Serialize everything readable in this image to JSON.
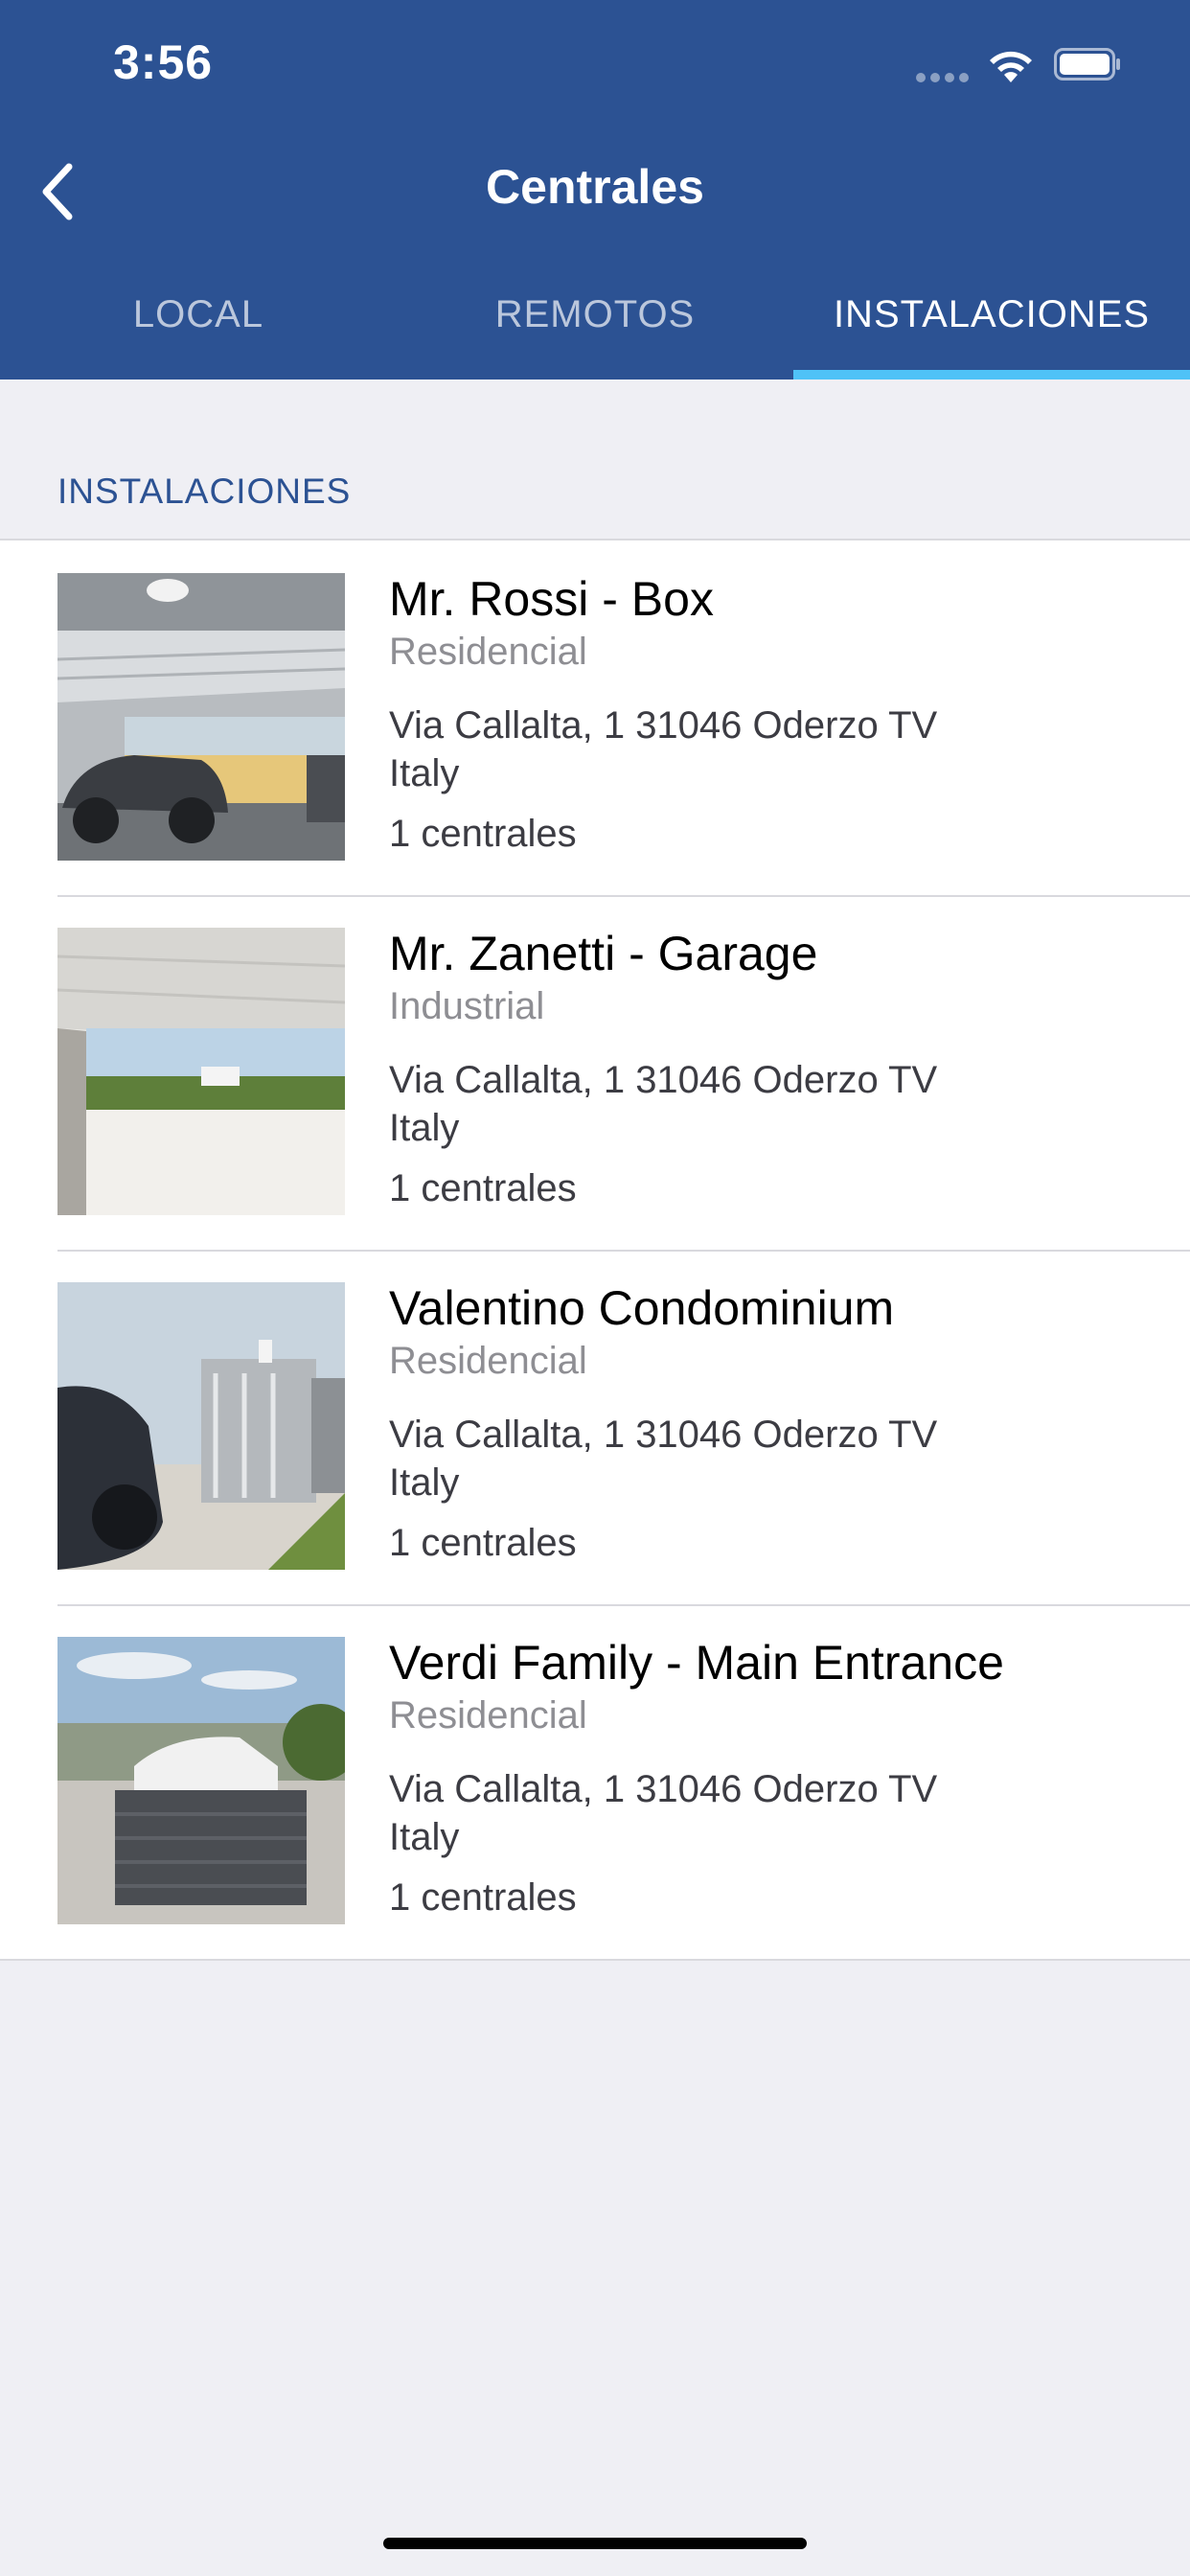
{
  "status_bar": {
    "time": "3:56"
  },
  "nav": {
    "title": "Centrales",
    "back_icon": "chevron-left-icon"
  },
  "tabs": [
    {
      "label": "LOCAL",
      "active": false
    },
    {
      "label": "REMOTOS",
      "active": false
    },
    {
      "label": "INSTALACIONES",
      "active": true
    }
  ],
  "section": {
    "header": "INSTALACIONES"
  },
  "installations": [
    {
      "title": "Mr. Rossi - Box",
      "type": "Residencial",
      "address": "Via Callalta, 1 31046 Oderzo TV Italy",
      "count": "1 centrales"
    },
    {
      "title": "Mr. Zanetti - Garage",
      "type": "Industrial",
      "address": "Via Callalta, 1 31046 Oderzo TV Italy",
      "count": "1 centrales"
    },
    {
      "title": "Valentino Condominium",
      "type": "Residencial",
      "address": "Via Callalta, 1 31046 Oderzo TV Italy",
      "count": "1 centrales"
    },
    {
      "title": "Verdi Family - Main Entrance",
      "type": "Residencial",
      "address": "Via Callalta, 1 31046 Oderzo TV Italy",
      "count": "1 centrales"
    }
  ],
  "colors": {
    "header_bg": "#2c5293",
    "tab_indicator": "#4fc2f7",
    "page_bg": "#efeff4"
  }
}
